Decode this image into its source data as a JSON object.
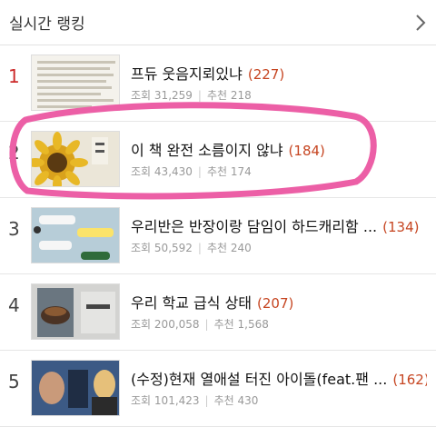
{
  "header": {
    "title": "실시간 랭킹",
    "chevron_icon": "chevron-right-icon"
  },
  "ranking": [
    {
      "rank": "1",
      "title": "프듀 웃음지뢰있냐",
      "count": "(227)",
      "views_label": "조회",
      "views": "31,259",
      "likes_label": "추천",
      "likes": "218"
    },
    {
      "rank": "2",
      "title": "이 책 완전 소름이지 않냐",
      "count": "(184)",
      "views_label": "조회",
      "views": "43,430",
      "likes_label": "추천",
      "likes": "174"
    },
    {
      "rank": "3",
      "title": "우리반은 반장이랑 담임이 하드캐리함 ...",
      "count": "(134)",
      "views_label": "조회",
      "views": "50,592",
      "likes_label": "추천",
      "likes": "240"
    },
    {
      "rank": "4",
      "title": "우리 학교 급식 상태",
      "count": "(207)",
      "views_label": "조회",
      "views": "200,058",
      "likes_label": "추천",
      "likes": "1,568"
    },
    {
      "rank": "5",
      "title": "(수정)현재 열애설 터진 아이돌(feat.팬 ...",
      "count": "(162)",
      "views_label": "조회",
      "views": "101,423",
      "likes_label": "추천",
      "likes": "430"
    }
  ],
  "colors": {
    "rank_first": "#cc2a2a",
    "comment_count": "#c64521",
    "highlight": "#ec5fa6"
  }
}
